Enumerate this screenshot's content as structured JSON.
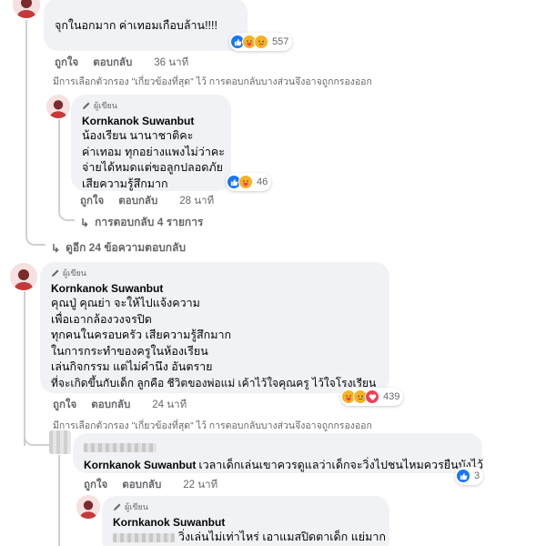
{
  "author_badge": "ผู้เขียน",
  "comment1": {
    "text": "จุกในอกมาก ค่าเทอมเกือบล้าน!!!!",
    "reaction_count": "557",
    "like_label": "ถูกใจ",
    "reply_label": "ตอบกลับ",
    "time": "36 นาที",
    "filter_note": "มีการเลือกตัวกรอง \"เกี่ยวข้องที่สุด\" ไว้ การตอบกลับบางส่วนจึงอาจถูกกรองออก"
  },
  "reply1": {
    "name": "Kornkanok Suwanbut",
    "lines": [
      "น้องเรียน นานาชาติคะ",
      "ค่าเทอม ทุกอย่างแพงไม่ว่าคะ",
      "จ่ายได้หมดแต่ขอลูกปลอดภัย",
      "เสียความรู้สึกมาก"
    ],
    "reaction_count": "46",
    "like_label": "ถูกใจ",
    "reply_label": "ตอบกลับ",
    "time": "28 นาที",
    "more_replies": "การตอบกลับ 4 รายการ"
  },
  "see_more": "ดูอีก 24 ข้อความตอบกลับ",
  "comment2": {
    "name": "Kornkanok Suwanbut",
    "lines": [
      "คุณปู่ คุณย่า จะให้ไปแจ้งความ",
      "เพื่อเอากล้องวงจรปิด",
      "ทุกคนในครอบครัว เสียความรู้สึกมาก",
      "ในการกระทำของครูในห้องเรียน",
      "เล่นกิจกรรม แต่ไม่คำนึง อันตราย",
      "ที่จะเกิดขึ้นกับเด็ก ลูกคือ ชีวิตของพ่อแม่ เค้าไว้ใจคุณครู ไว้ใจโรงเรียน"
    ],
    "reaction_count": "439",
    "like_label": "ถูกใจ",
    "reply_label": "ตอบกลับ",
    "time": "24 นาที",
    "filter_note": "มีการเลือกตัวกรอง \"เกี่ยวข้องที่สุด\" ไว้ การตอบกลับบางส่วนจึงอาจถูกกรองออก"
  },
  "reply2": {
    "name": "Kornkanok Suwanbut",
    "text": "เวลาเด็กเล่นเขาควรดูแลว่าเด็กจะวิ่งไปชนไหมควรยืนบังไว้",
    "reaction_count": "3",
    "like_label": "ถูกใจ",
    "reply_label": "ตอบกลับ",
    "time": "22 นาที"
  },
  "reply3": {
    "name": "Kornkanok Suwanbut",
    "text": "วิ่งเล่นไม่เท่าไหร่ เอาแมสปิดตาเด็ก แย่มาก"
  }
}
